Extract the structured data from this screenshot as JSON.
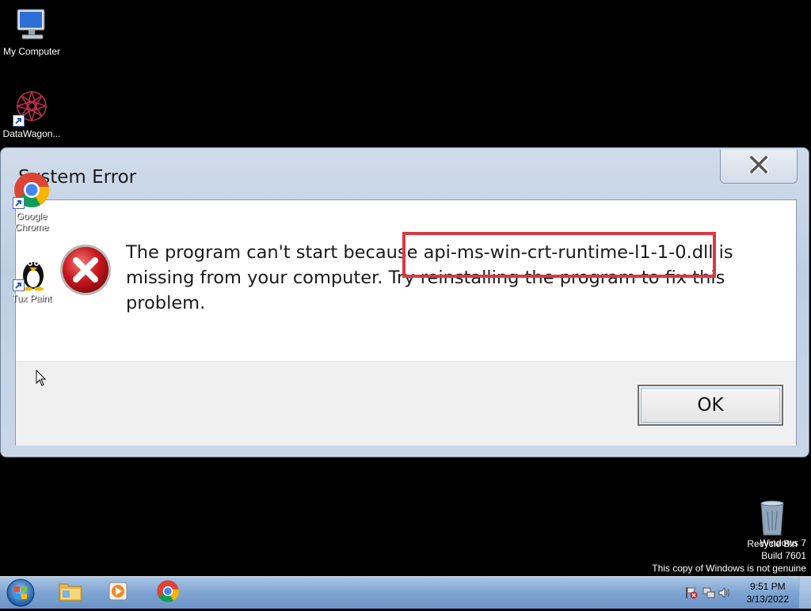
{
  "desktop": {
    "icons": [
      {
        "name": "my-computer",
        "label": "My Computer"
      },
      {
        "name": "datawagon",
        "label": "DataWagon..."
      },
      {
        "name": "google-chrome",
        "label": "Google Chrome"
      },
      {
        "name": "tux-paint",
        "label": "Tux Paint"
      },
      {
        "name": "recycle-bin",
        "label": "Recycle Bin"
      }
    ]
  },
  "dialog": {
    "title": "System Error",
    "message_before": "The program can't start because ",
    "dll_name": "api-ms-win-crt-runtime-l1-1-0.dll",
    "message_after": " is missing from your computer. Try reinstalling the program to fix this problem.",
    "ok_label": "OK",
    "highlight_color": "#d83a43",
    "icon": "error-icon"
  },
  "watermark": {
    "line1": "Windows 7",
    "line2": "Build 7601",
    "line3": "This copy of Windows is not genuine"
  },
  "taskbar": {
    "items": [
      "windows-explorer-icon",
      "media-player-icon",
      "chrome-icon"
    ],
    "clock_time": "9:51 PM",
    "clock_date": "3/13/2022"
  }
}
